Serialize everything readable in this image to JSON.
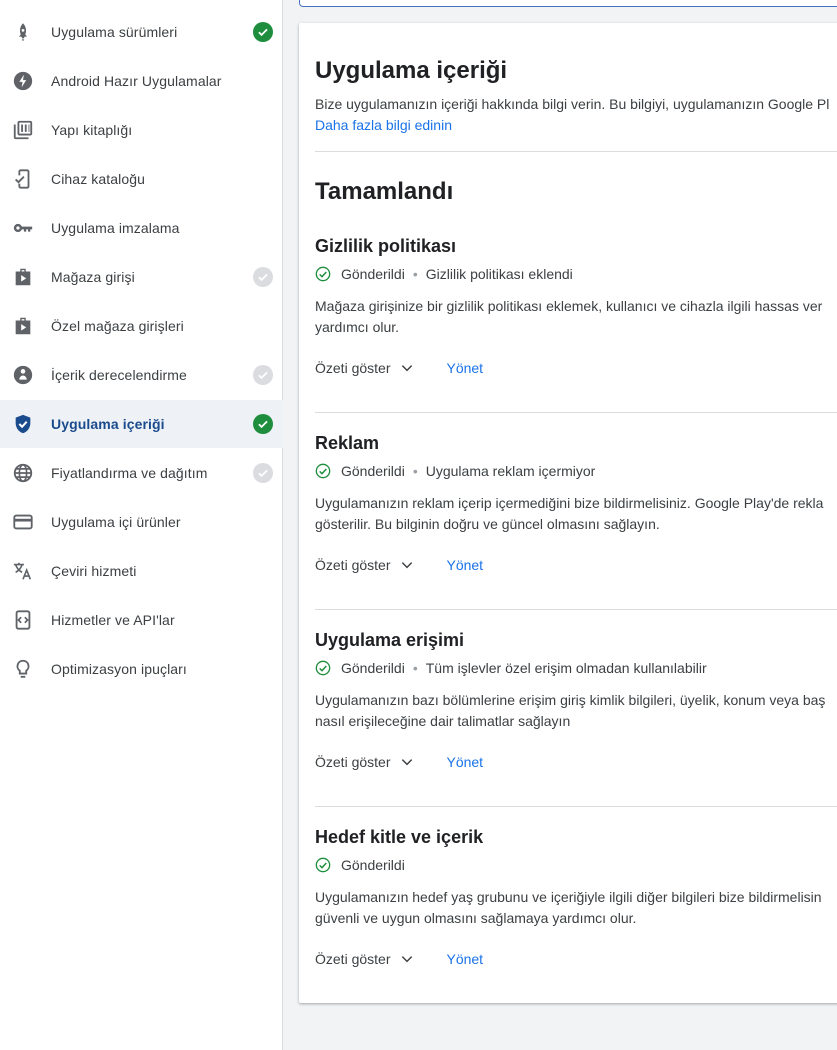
{
  "sidebar": {
    "items": [
      {
        "label": "Uygulama sürümleri",
        "icon": "rocket-icon",
        "status": "done"
      },
      {
        "label": "Android Hazır Uygulamalar",
        "icon": "bolt-icon",
        "status": ""
      },
      {
        "label": "Yapı kitaplığı",
        "icon": "library-icon",
        "status": ""
      },
      {
        "label": "Cihaz kataloğu",
        "icon": "device-check-icon",
        "status": ""
      },
      {
        "label": "Uygulama imzalama",
        "icon": "key-icon",
        "status": ""
      },
      {
        "label": "Mağaza girişi",
        "icon": "store-play-icon",
        "status": "pending"
      },
      {
        "label": "Özel mağaza girişleri",
        "icon": "store-play-icon",
        "status": ""
      },
      {
        "label": "İçerik derecelendirme",
        "icon": "rating-icon",
        "status": "pending"
      },
      {
        "label": "Uygulama içeriği",
        "icon": "shield-icon",
        "status": "done",
        "active": true
      },
      {
        "label": "Fiyatlandırma ve dağıtım",
        "icon": "globe-icon",
        "status": "pending"
      },
      {
        "label": "Uygulama içi ürünler",
        "icon": "card-icon",
        "status": ""
      },
      {
        "label": "Çeviri hizmeti",
        "icon": "translate-icon",
        "status": ""
      },
      {
        "label": "Hizmetler ve API'lar",
        "icon": "api-icon",
        "status": ""
      },
      {
        "label": "Optimizasyon ipuçları",
        "icon": "lightbulb-icon",
        "status": ""
      }
    ]
  },
  "main": {
    "title": "Uygulama içeriği",
    "description": "Bize uygulamanızın içeriği hakkında bilgi verin. Bu bilgiyi, uygulamanızın Google Pl",
    "learn_more": "Daha fazla bilgi edinin",
    "section_title": "Tamamlandı",
    "items": [
      {
        "title": "Gizlilik politikası",
        "status": "Gönderildi",
        "detail": "Gizlilik politikası eklendi",
        "desc_line1": "Mağaza girişinize bir gizlilik politikası eklemek, kullanıcı ve cihazla ilgili hassas ver",
        "desc_line2": "yardımcı olur.",
        "summary": "Özeti göster",
        "manage": "Yönet"
      },
      {
        "title": "Reklam",
        "status": "Gönderildi",
        "detail": "Uygulama reklam içermiyor",
        "desc_line1": "Uygulamanızın reklam içerip içermediğini bize bildirmelisiniz. Google Play'de rekla",
        "desc_line2": "gösterilir. Bu bilginin doğru ve güncel olmasını sağlayın.",
        "summary": "Özeti göster",
        "manage": "Yönet"
      },
      {
        "title": "Uygulama erişimi",
        "status": "Gönderildi",
        "detail": "Tüm işlevler özel erişim olmadan kullanılabilir",
        "desc_line1": "Uygulamanızın bazı bölümlerine erişim giriş kimlik bilgileri, üyelik, konum veya baş",
        "desc_line2": "nasıl erişileceğine dair talimatlar sağlayın",
        "summary": "Özeti göster",
        "manage": "Yönet"
      },
      {
        "title": "Hedef kitle ve içerik",
        "status": "Gönderildi",
        "detail": "",
        "desc_line1": "Uygulamanızın hedef yaş grubunu ve içeriğiyle ilgili diğer bilgileri bize bildirmelisin",
        "desc_line2": "güvenli ve uygun olmasını sağlamaya yardımcı olur.",
        "summary": "Özeti göster",
        "manage": "Yönet"
      }
    ]
  },
  "colors": {
    "accent": "#1a73e8",
    "active_bg": "#eef1f6",
    "active_text": "#1a4b8c",
    "success": "#1e8e3e"
  }
}
